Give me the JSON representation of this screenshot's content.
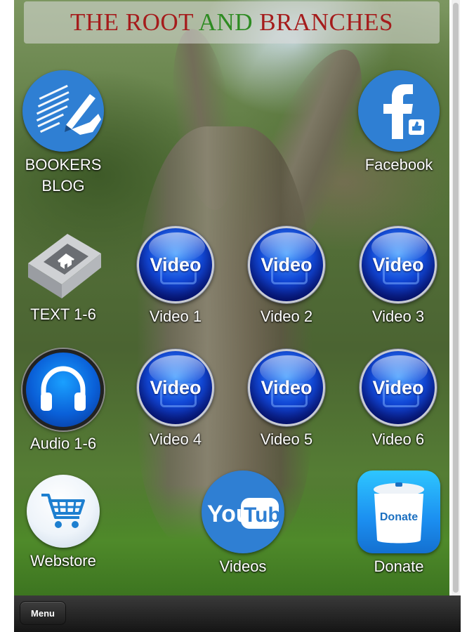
{
  "header": {
    "title_part1": "THE ROOT ",
    "title_part2": "AND",
    "title_part3": " BRANCHES"
  },
  "tiles": {
    "bookers_blog": {
      "label_line1": "BOOKERS",
      "label_line2": "BLOG",
      "icon": "blog-writing-icon"
    },
    "facebook": {
      "label": "Facebook",
      "icon": "facebook-icon"
    },
    "text": {
      "label": "TEXT 1-6",
      "icon": "book-home-icon"
    },
    "video1": {
      "label": "Video 1",
      "icon_text": "Video"
    },
    "video2": {
      "label": "Video 2",
      "icon_text": "Video"
    },
    "video3": {
      "label": "Video 3",
      "icon_text": "Video"
    },
    "audio": {
      "label": "Audio 1-6",
      "icon": "headphones-icon"
    },
    "video4": {
      "label": "Video 4",
      "icon_text": "Video"
    },
    "video5": {
      "label": "Video 5",
      "icon_text": "Video"
    },
    "video6": {
      "label": "Video 6",
      "icon_text": "Video"
    },
    "webstore": {
      "label": "Webstore",
      "icon": "shopping-cart-icon"
    },
    "videos": {
      "label": "Videos",
      "icon_text_you": "You",
      "icon_text_tube": "Tube"
    },
    "donate": {
      "label": "Donate",
      "icon_text": "Donate"
    }
  },
  "menubar": {
    "menu_label": "Menu"
  },
  "colors": {
    "title_red": "#a51c1c",
    "title_green": "#2e8b22",
    "icon_blue": "#2f7fd3",
    "video_blue": "#1249d8"
  }
}
